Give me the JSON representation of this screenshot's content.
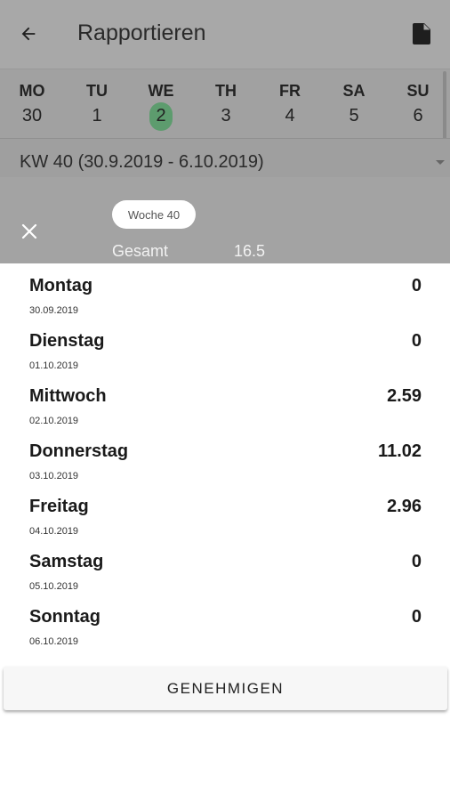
{
  "appbar": {
    "title": "Rapportieren",
    "back_icon": "arrow-left-icon",
    "action_icon": "document-icon"
  },
  "week": {
    "days": [
      {
        "name": "MO",
        "date": "30"
      },
      {
        "name": "TU",
        "date": "1"
      },
      {
        "name": "WE",
        "date": "2",
        "selected": true
      },
      {
        "name": "TH",
        "date": "3"
      },
      {
        "name": "FR",
        "date": "4"
      },
      {
        "name": "SA",
        "date": "5"
      },
      {
        "name": "SU",
        "date": "6"
      }
    ],
    "selected_color": "#5d9c6e"
  },
  "week_selector": {
    "value": "KW 40 (30.9.2019 - 6.10.2019)"
  },
  "summary": {
    "chip": "Woche 40",
    "total_label": "Gesamt",
    "total_value": "16.5",
    "close_icon": "close-icon"
  },
  "entries": [
    {
      "day": "Montag",
      "date": "30.09.2019",
      "hours": "0"
    },
    {
      "day": "Dienstag",
      "date": "01.10.2019",
      "hours": "0"
    },
    {
      "day": "Mittwoch",
      "date": "02.10.2019",
      "hours": "2.59"
    },
    {
      "day": "Donnerstag",
      "date": "03.10.2019",
      "hours": "11.02"
    },
    {
      "day": "Freitag",
      "date": "04.10.2019",
      "hours": "2.96"
    },
    {
      "day": "Samstag",
      "date": "05.10.2019",
      "hours": "0"
    },
    {
      "day": "Sonntag",
      "date": "06.10.2019",
      "hours": "0"
    }
  ],
  "approve_label": "GENEHMIGEN"
}
